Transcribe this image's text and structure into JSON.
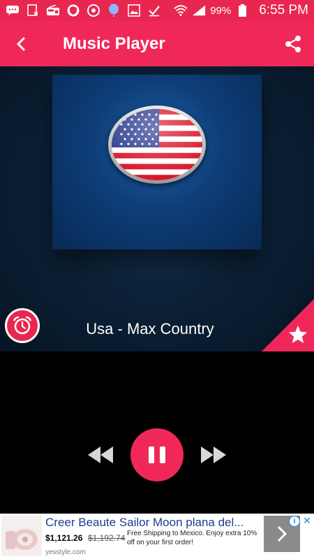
{
  "status_bar": {
    "battery": "99%",
    "time": "6:55 PM",
    "icons": [
      "message-icon",
      "download-icon",
      "radio-icon",
      "shield-icon",
      "chrome-icon",
      "balloon-icon",
      "image-icon",
      "check-icon",
      "wifi-icon",
      "signal-icon",
      "battery-icon"
    ]
  },
  "app_bar": {
    "title": "Music Player",
    "back_icon": "back-arrow-icon",
    "share_icon": "share-icon"
  },
  "player": {
    "station_name": "Usa - Max Country",
    "artwork": "usa-flag-icon",
    "alarm_icon": "alarm-clock-icon",
    "favorite_icon": "star-icon",
    "controls": [
      "rewind-icon",
      "pause-icon",
      "fast-forward-icon"
    ]
  },
  "ad": {
    "title": "Creer Beaute Sailor Moon plana del...",
    "price": "$1,121.26",
    "old_price": "$1,192.74",
    "description": "Free Shipping to Mexico. Enjoy extra 10% off on your first order!",
    "domain": "yesstyle.com",
    "info_label": "i",
    "close_label": "✕"
  },
  "colors": {
    "accent": "#f0285a",
    "status_bar": "#e8264f",
    "hero_bg": "#0c2238",
    "artwork_bg": "#0e3d78"
  }
}
